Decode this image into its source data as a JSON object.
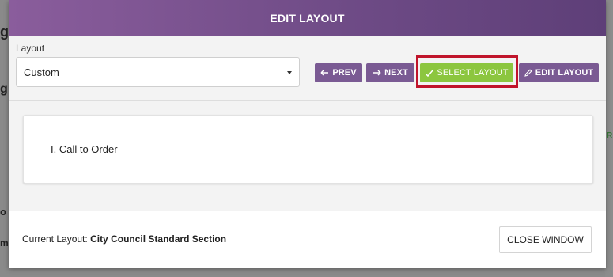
{
  "background": {
    "frag_top": "ge",
    "frag_mid": "g",
    "frag_low": "o",
    "frag_bottom": "m",
    "frag_right": "R"
  },
  "modal": {
    "title": "EDIT LAYOUT"
  },
  "toolbar": {
    "layout_label": "Layout",
    "layout_select_value": "Custom",
    "prev_label": "PREV",
    "next_label": "NEXT",
    "select_layout_label": "SELECT LAYOUT",
    "edit_layout_label": "EDIT LAYOUT"
  },
  "content": {
    "items": [
      "I. Call to Order"
    ]
  },
  "footer": {
    "current_layout_prefix": "Current Layout:",
    "current_layout_value": "City Council Standard Section",
    "close_label": "CLOSE WINDOW"
  },
  "colors": {
    "header_purple": "#6d4a85",
    "button_purple": "#7a5a93",
    "select_green": "#8cc63f",
    "highlight_red": "#c0142b"
  }
}
